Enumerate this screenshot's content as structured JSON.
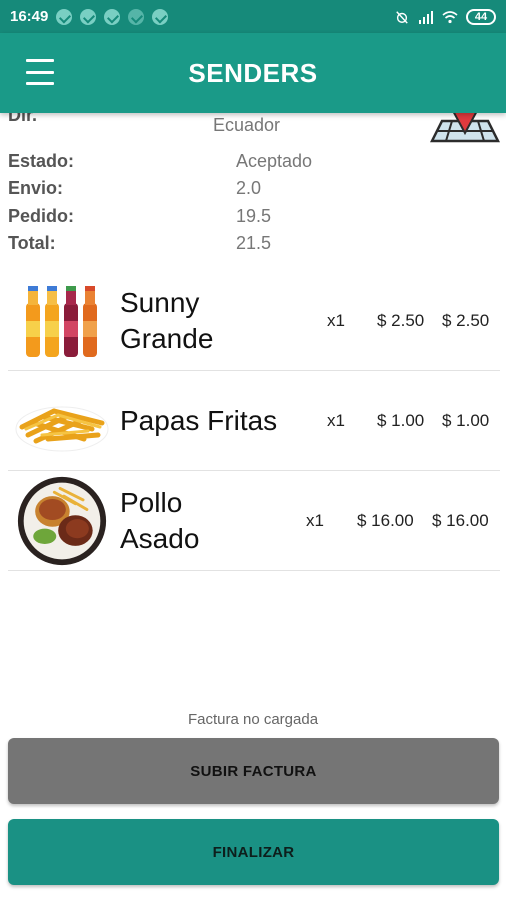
{
  "status_bar": {
    "time": "16:49",
    "battery": "44"
  },
  "app_bar": {
    "title": "SENDERS",
    "menu_icon": "hamburger-menu-icon"
  },
  "order_info": {
    "dir_label": "Dir.",
    "dir_value": "Ecuador",
    "estado_label": "Estado:",
    "estado_value": "Aceptado",
    "envio_label": "Envio:",
    "envio_value": "2.0",
    "pedido_label": "Pedido:",
    "pedido_value": "19.5",
    "total_label": "Total:",
    "total_value": "21.5"
  },
  "items": [
    {
      "name_line1": "Sunny",
      "name_line2": "Grande",
      "qty": "x1",
      "price": "$ 2.50",
      "total": "$ 2.50",
      "image": "juice-bottles"
    },
    {
      "name_line1": "Papas Fritas",
      "name_line2": "",
      "qty": "x1",
      "price": "$ 1.00",
      "total": "$ 1.00",
      "image": "french-fries"
    },
    {
      "name_line1": "Pollo",
      "name_line2": "Asado",
      "qty": "x1",
      "price": "$ 16.00",
      "total": "$ 16.00",
      "image": "roast-chicken-plate"
    }
  ],
  "footer": {
    "factura_note": "Factura no cargada",
    "upload_button": "SUBIR FACTURA",
    "finalize_button": "FINALIZAR"
  },
  "colors": {
    "primary": "#1a9a88",
    "status_bar": "#168a7a",
    "upload_button": "#757575",
    "finalize_button": "#1a9184"
  }
}
